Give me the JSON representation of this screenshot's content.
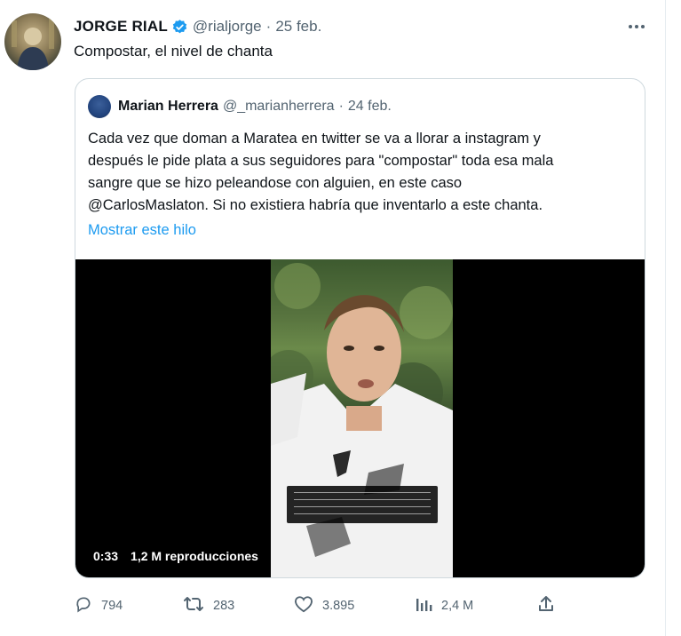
{
  "tweet": {
    "author": {
      "name": "JORGE RIAL",
      "handle": "@rialjorge",
      "separator": "·",
      "date": "25 feb."
    },
    "text": "Compostar, el nivel de chanta",
    "quoted": {
      "author": {
        "name": "Marian Herrera",
        "handle": "@_marianherrera",
        "separator": "·",
        "date": "24 feb."
      },
      "lines": [
        "Cada vez que doman a Maratea en twitter se va a llorar a instagram y",
        "después le pide plata a sus seguidores para \"compostar\" toda esa mala",
        "sangre que se hizo peleandose con alguien, en este caso",
        "@CarlosMaslaton. Si no existiera habría que inventarlo a este chanta."
      ],
      "show_thread": "Mostrar este hilo",
      "video": {
        "duration": "0:33",
        "views": "1,2 M reproducciones"
      }
    },
    "actions": {
      "replies": "794",
      "retweets": "283",
      "likes": "3.895",
      "views": "2,4 M"
    }
  },
  "colors": {
    "accent": "#1d9bf0",
    "secondary_text": "#536471",
    "border": "#cfd9de"
  },
  "icons": [
    "verified-badge-icon",
    "more-options-icon",
    "reply-icon",
    "retweet-icon",
    "like-icon",
    "views-icon",
    "share-icon"
  ]
}
